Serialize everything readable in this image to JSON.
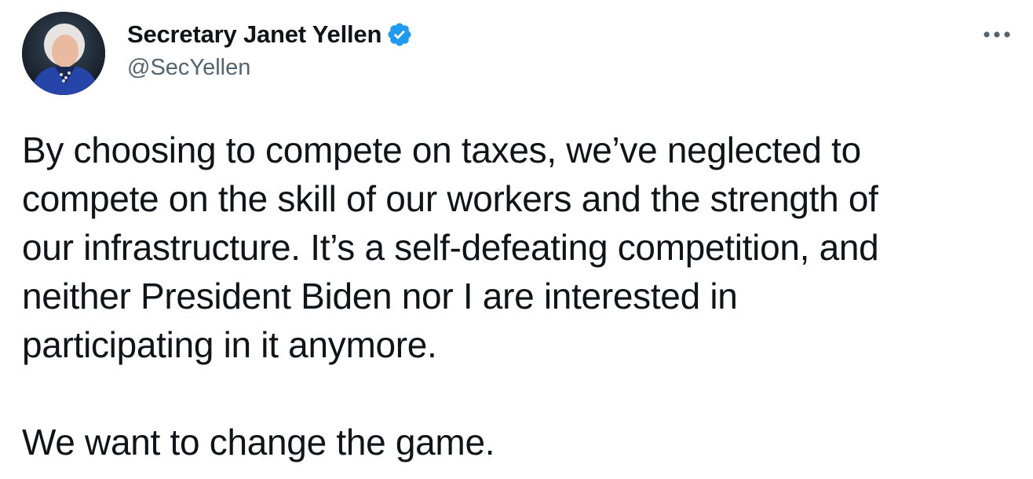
{
  "tweet": {
    "author": {
      "display_name": "Secretary Janet Yellen",
      "handle": "@SecYellen",
      "verified": true,
      "avatar_icon": "profile-photo"
    },
    "more_icon": "more-horizontal-icon",
    "text": "By choosing to compete on taxes, we’ve neglected to\ncompete on the skill of our workers and the strength of\nour infrastructure. It’s a self-defeating competition, and\nneither President Biden nor I are interested in\nparticipating in it anymore.\n\nWe want to change the game."
  },
  "colors": {
    "text_primary": "#0f1419",
    "text_secondary": "#536471",
    "verified_blue": "#1d9bf0",
    "background": "#ffffff"
  }
}
